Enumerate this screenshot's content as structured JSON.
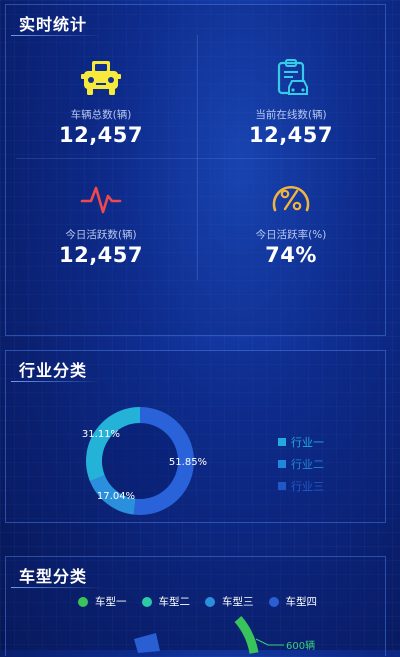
{
  "stats_panel": {
    "title": "实时统计",
    "cards": [
      {
        "label": "车辆总数(辆)",
        "value": "12,457",
        "icon": "car-icon",
        "icon_color": "#f8ea3a"
      },
      {
        "label": "当前在线数(辆)",
        "value": "12,457",
        "icon": "clipboard-car-icon",
        "icon_color": "#36cbe6"
      },
      {
        "label": "今日活跃数(辆)",
        "value": "12,457",
        "icon": "pulse-icon",
        "icon_color": "#f0484f"
      },
      {
        "label": "今日活跃率(%)",
        "value": "74%",
        "icon": "percent-icon",
        "icon_color": "#f2b440"
      }
    ]
  },
  "industry_panel": {
    "title": "行业分类",
    "chart_data": {
      "type": "pie",
      "variant": "donut",
      "slices": [
        {
          "name": "行业一",
          "value": 51.85,
          "label": "51.85%",
          "color": "#2a63d9"
        },
        {
          "name": "行业二",
          "value": 17.04,
          "label": "17.04%",
          "color": "#2a8fdc"
        },
        {
          "name": "行业三",
          "value": 31.11,
          "label": "31.11%",
          "color": "#25b2d8"
        }
      ],
      "legend_placement": "right"
    },
    "legend": [
      {
        "name": "行业一",
        "color": "#22a9dd",
        "text_color": "#22a9dd"
      },
      {
        "name": "行业二",
        "color": "#1f88d8",
        "text_color": "#1f88d8"
      },
      {
        "name": "行业三",
        "color": "#2158c8",
        "text_color": "#2158c8"
      }
    ]
  },
  "car_panel": {
    "title": "车型分类",
    "legend": [
      {
        "name": "车型一",
        "color": "#39c35b"
      },
      {
        "name": "车型二",
        "color": "#2dcaa8"
      },
      {
        "name": "车型三",
        "color": "#2a8fdc"
      },
      {
        "name": "车型四",
        "color": "#2a5fd3"
      }
    ],
    "annotation": "600辆",
    "annotation_color": "#37d07a"
  }
}
